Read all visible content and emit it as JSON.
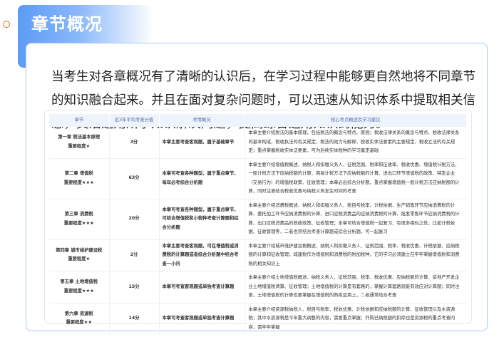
{
  "section": {
    "title": "章节概况",
    "accent": "#5d9bf5",
    "marker_color": "#e8661e"
  },
  "intro": "当考生对各章概况有了清晰的认识后，在学习过程中能够更自然地将不同章节的知识融合起来。并且在面对复杂问题时，可以迅速从知识体系中提取相关信息，灵活运用所学知识解决问题，提高综合运用知识的能力。",
  "table": {
    "headers": [
      "章节",
      "近3年平均考查分值",
      "考情概况",
      "核心考点概述及学习建议"
    ],
    "rows": [
      {
        "chapter": "第一章 税法基本原理",
        "importance": "重要程度★",
        "score": "3分",
        "overview": "本章主要考查客观题，属于基础章节",
        "summary": "本章主要介绍税法的基本原理，包括税法的概念与特点、原则；税收法律关系的概念与特点、税收法律关系的基本构成、税收执法的有关规定、税法的效力与解释、税收实体法要素的主要规定、税收立法的有关规定；重点掌握税收实体法要素，可为后续实体税种的学习奠定基础"
      },
      {
        "chapter": "第二章 增值税",
        "importance": "重要程度★★★",
        "score": "63分",
        "overview": "本章可考查各种题型，属于重点章节，每年必考综合分析题",
        "summary": "本章主要介绍增值税概述、纳税人和扣缴义务人、征税范围、税率和征收率、税收优惠、增值税计税方法、一般计税方法下应纳税额的计算、简易计税方法下应纳税额的计算、进出口环节增值税的政策、特定企业（交易行为）的增值税政策、征收管理；本章必出综合分析题，重点掌握增值税一般计税方法应纳税额的计算，同时注意结合税收优惠与纳税义务发生时间的考查"
      },
      {
        "chapter": "第三章 消费税",
        "importance": "重要程度★★★",
        "score": "20分",
        "overview": "本章可考查各种题型，属于重点章节，可结合增值税和小税种考查计算题和综合分析题",
        "summary": "本章主要介绍消费税概述、纳税人和扣缴义务人、税目与税率、计税依据、生产销售环节应纳消费税的计算、委托加工环节应纳消费税的计算、进口应税消费品的应纳消费税的计算、批发零售环节应纳消费税的计算、出口应税消费品的税收政策、征收管理；本章可结合增值税一起复习，有很多相似之处，比如计税依据、征收管理等，二者也常结合考查计算题或综合分析题，可一起复习"
      },
      {
        "chapter": "第四章 城市维护建设税",
        "importance": "重要程度★",
        "score": "2分",
        "overview": "本章主要考查客观题，可在增值税或消费税的计算题或者综合分析题中结合考查一小问",
        "summary": "本章主要介绍城市维护建设税概述、纳税人和扣缴义务人、征税范围、税率、税收优惠、计税依据、应纳税额的计算和征收管理；城建税作为增值税和消费税的附加税种，它的学习必须建立在牢牢掌握增值税和消费税的相关知识上"
      },
      {
        "chapter": "第五章 土地增值税",
        "importance": "重要程度★★★",
        "score": "15分",
        "overview": "本章可考查客观题或单独考查计算题",
        "summary": "本章主要介绍土地增值税概述、纳税义务人、征税范围、税率、税收优惠、应纳税额的计算、房地产开发企业土地增值税清算、征收管理；土地增值税的计算是有套路的，掌握计算套路就能有效应对计算题；同时注意，土地增值税的计算也要掌握在增值税的熟练运用上，二者通常结合考查"
      },
      {
        "chapter": "第六章 资源税",
        "importance": "重要程度★★",
        "score": "14分",
        "overview": "本章可考查客观题或单独考查计算题",
        "summary": "本章主要介绍资源税纳税人、税目与税率、税收优惠、计税依据和应纳税额的计算、征收管理以及水资源税；其中水资源税是今年重大调整的内容，需要重点掌握；外购已纳税额的扣除也是资源税的重点考查内容，需牢牢掌握"
      }
    ]
  }
}
